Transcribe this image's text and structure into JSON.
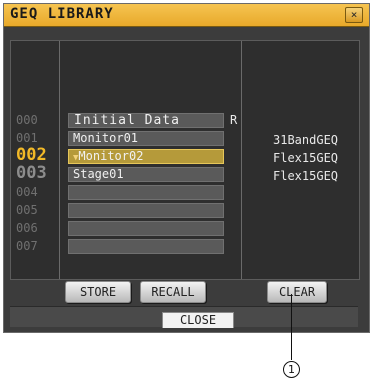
{
  "window": {
    "title": "GEQ LIBRARY",
    "close_icon": "×"
  },
  "rows": [
    {
      "num": "000",
      "name": "Initial Data",
      "readonly": "R",
      "type": ""
    },
    {
      "num": "001",
      "name": "Monitor01",
      "readonly": "",
      "type": "31BandGEQ"
    },
    {
      "num": "002",
      "name": "Monitor02",
      "readonly": "",
      "type": "Flex15GEQ",
      "marker": "▼"
    },
    {
      "num": "003",
      "name": "Stage01",
      "readonly": "",
      "type": "Flex15GEQ"
    },
    {
      "num": "004",
      "name": "",
      "readonly": "",
      "type": ""
    },
    {
      "num": "005",
      "name": "",
      "readonly": "",
      "type": ""
    },
    {
      "num": "006",
      "name": "",
      "readonly": "",
      "type": ""
    },
    {
      "num": "007",
      "name": "",
      "readonly": "",
      "type": ""
    }
  ],
  "buttons": {
    "store": "STORE",
    "recall": "RECALL",
    "clear": "CLEAR",
    "close": "CLOSE"
  },
  "callout": {
    "label": "1"
  },
  "colors": {
    "accent": "#f2b927",
    "title_bar": "#e8a92a",
    "selected_row": "#b59a3a"
  }
}
